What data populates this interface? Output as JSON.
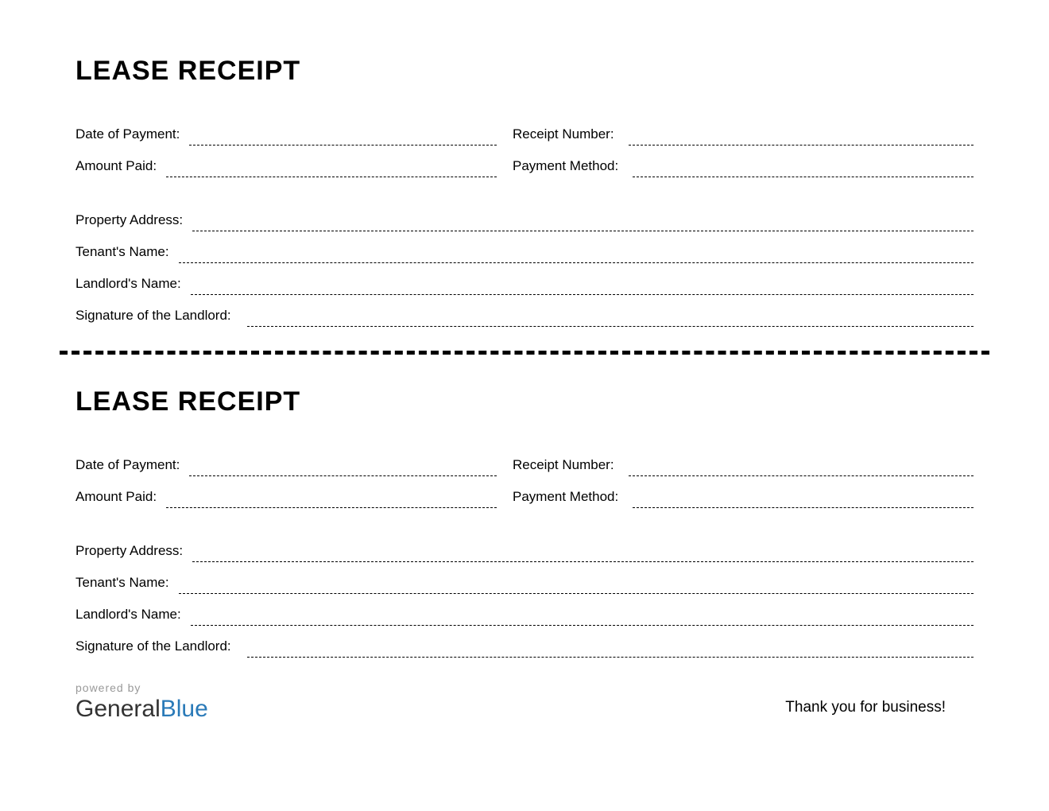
{
  "receipt1": {
    "title": "LEASE RECEIPT",
    "fields": {
      "date_of_payment": "Date of Payment:",
      "receipt_number": "Receipt Number:",
      "amount_paid": "Amount Paid:",
      "payment_method": "Payment Method:",
      "property_address": "Property Address:",
      "tenants_name": "Tenant's Name:",
      "landlords_name": "Landlord's Name:",
      "signature": "Signature of the Landlord:"
    }
  },
  "receipt2": {
    "title": "LEASE RECEIPT",
    "fields": {
      "date_of_payment": "Date of Payment:",
      "receipt_number": "Receipt Number:",
      "amount_paid": "Amount Paid:",
      "payment_method": "Payment Method:",
      "property_address": "Property Address:",
      "tenants_name": "Tenant's Name:",
      "landlords_name": "Landlord's Name:",
      "signature": "Signature of the Landlord:"
    }
  },
  "footer": {
    "powered_by": "powered by",
    "logo_part1": "General",
    "logo_part2": "Blue",
    "thank_you": "Thank you for business!"
  }
}
